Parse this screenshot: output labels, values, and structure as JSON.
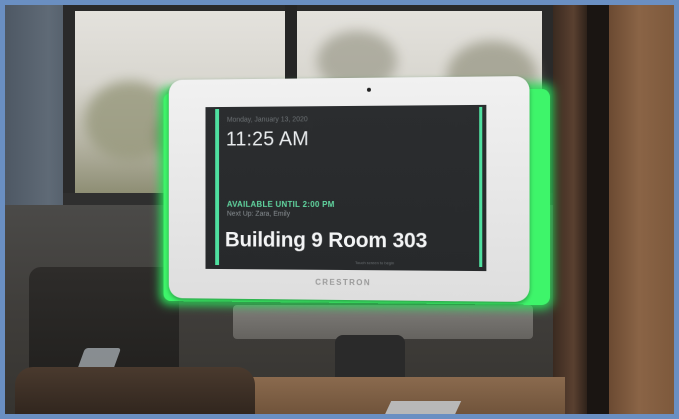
{
  "photo": {
    "frame_color": "#6a8fc2",
    "glow_color": "#3ef56a"
  },
  "panel": {
    "date": "Monday, January 13, 2020",
    "time": "11:25 AM",
    "status": "AVAILABLE UNTIL 2:00 PM",
    "next_up": "Next Up: Zara, Emily",
    "room": "Building 9 Room 303",
    "touch_hint": "Touch screen to begin",
    "accent_color": "#4fe0a0"
  },
  "device": {
    "brand": "CRESTRON"
  }
}
